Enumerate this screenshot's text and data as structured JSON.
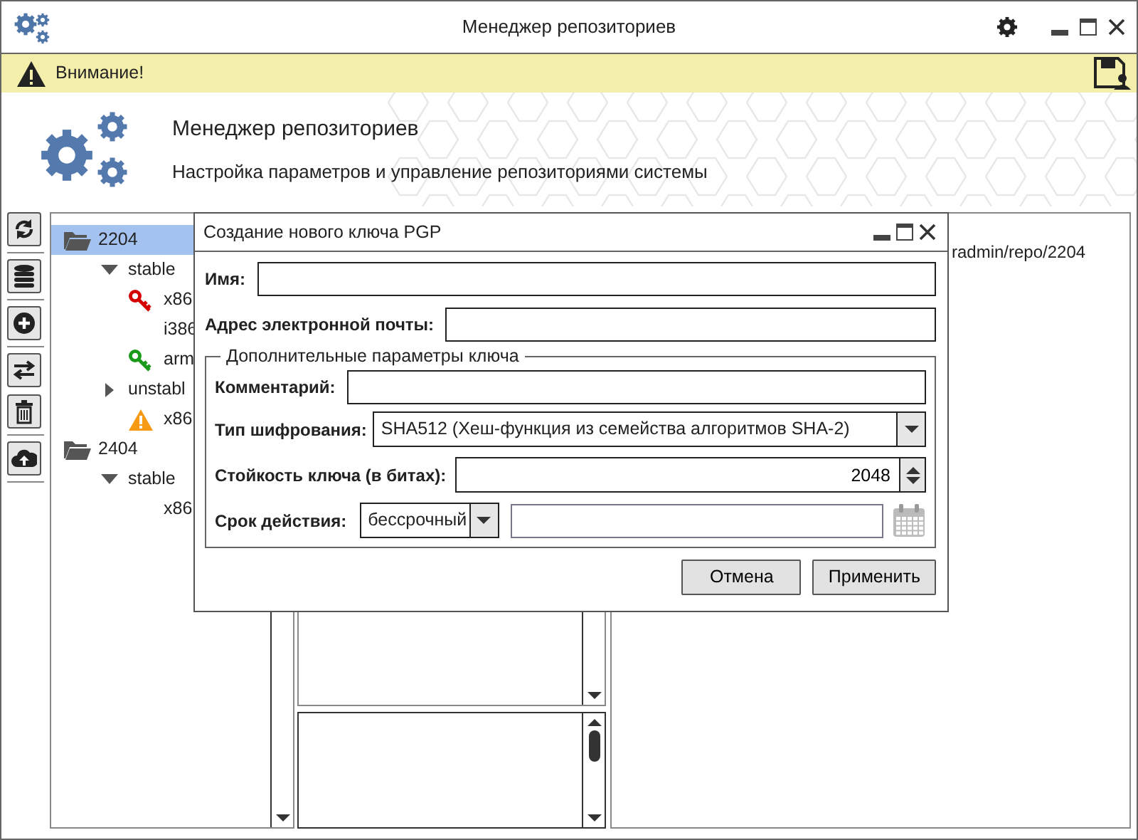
{
  "window": {
    "title": "Менеджер репозиториев"
  },
  "alert": {
    "text": "Внимание!"
  },
  "header": {
    "title": "Менеджер репозиториев",
    "subtitle": "Настройка параметров и управление репозиториями системы"
  },
  "tree": [
    {
      "label": "2204",
      "selected": true,
      "children": [
        {
          "label": "stable",
          "expanded": true,
          "children": [
            {
              "label": "x86",
              "kind": "key",
              "color": "#d40000"
            },
            {
              "label": "i386",
              "kind": "plain"
            },
            {
              "label": "arm",
              "kind": "key",
              "color": "#1a9a1a"
            }
          ]
        },
        {
          "label": "unstabl",
          "expanded": false,
          "children": [
            {
              "label": "x86",
              "kind": "warning"
            }
          ]
        }
      ]
    },
    {
      "label": "2404",
      "selected": false,
      "children": [
        {
          "label": "stable",
          "expanded": true,
          "children": [
            {
              "label": "x86",
              "kind": "plain"
            }
          ]
        }
      ]
    }
  ],
  "info_path": "radmin/repo/2204",
  "dialog": {
    "title": "Создание нового ключа PGP",
    "name": {
      "label": "Имя:"
    },
    "email": {
      "label": "Адрес электронной почты:"
    },
    "group": {
      "title": "Дополнительные параметры ключа",
      "comment": {
        "label": "Комментарий:"
      },
      "cipher": {
        "label": "Тип шифрования:",
        "value": "SHA512 (Хеш-функция из семейства алгоритмов SHA-2)"
      },
      "strength": {
        "label": "Стойкость ключа (в битах):",
        "value": "2048"
      },
      "expiry": {
        "label": "Срок действия:",
        "value": "бессрочный"
      }
    },
    "buttons": [
      {
        "label": "Отмена"
      },
      {
        "label": "Применить"
      }
    ]
  }
}
